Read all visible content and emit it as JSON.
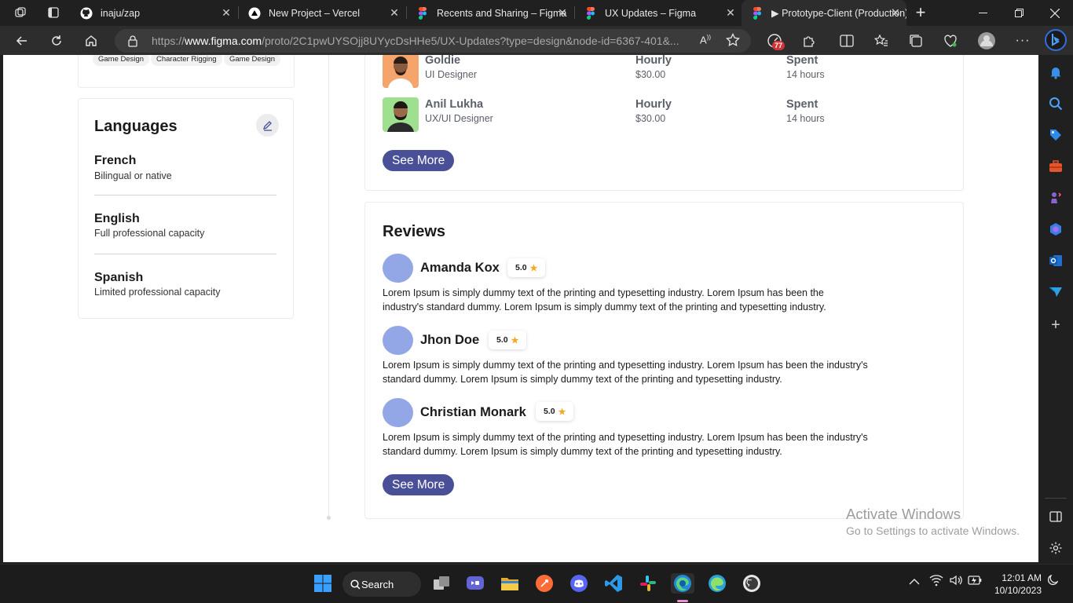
{
  "browser": {
    "tabs": [
      {
        "title": "inaju/zap",
        "active": false
      },
      {
        "title": "New Project – Vercel",
        "active": false
      },
      {
        "title": "Recents and Sharing – Figma",
        "active": false
      },
      {
        "title": "UX Updates – Figma",
        "active": false
      },
      {
        "title": "▶ Prototype-Client (Production)",
        "active": true
      }
    ],
    "url_prefix": "https://",
    "url_host": "www.figma.com",
    "url_path": "/proto/2C1pwUYSOjj8UYycDsHHe5/UX-Updates?type=design&node-id=6367-401&...",
    "extension_badge": "77",
    "accent": "#1a73e8"
  },
  "skills": {
    "chips": [
      "Game Design",
      "Character Rigging",
      "Game Design"
    ]
  },
  "languages": {
    "title": "Languages",
    "items": [
      {
        "name": "French",
        "level": "Bilingual or native"
      },
      {
        "name": "English",
        "level": "Full professional capacity"
      },
      {
        "name": "Spanish",
        "level": "Limited professional  capacity"
      }
    ]
  },
  "hires": {
    "rows": [
      {
        "name": "Goldie",
        "role": "UI Designer",
        "rate_label": "Hourly",
        "rate": "$30.00",
        "spent_label": "Spent",
        "spent": "14 hours"
      },
      {
        "name": "Anil Lukha",
        "role": "UX/UI Designer",
        "rate_label": "Hourly",
        "rate": "$30.00",
        "spent_label": "Spent",
        "spent": "14 hours"
      }
    ],
    "see_more": "See More"
  },
  "reviews": {
    "title": "Reviews",
    "items": [
      {
        "name": "Amanda Kox",
        "rating": "5.0",
        "text": "Lorem Ipsum is simply dummy text of the printing and typesetting industry. Lorem Ipsum has been the industry's standard dummy. Lorem Ipsum is simply dummy text of the printing and typesetting industry."
      },
      {
        "name": "Jhon Doe",
        "rating": "5.0",
        "text": "Lorem Ipsum is simply dummy text of the printing and typesetting industry. Lorem Ipsum has been the industry's standard dummy. Lorem Ipsum is simply dummy text of the printing and typesetting industry."
      },
      {
        "name": "Christian Monark",
        "rating": "5.0",
        "text": "Lorem Ipsum is simply dummy text of the printing and typesetting industry. Lorem Ipsum has been the industry's standard dummy. Lorem Ipsum is simply dummy text of the printing and typesetting industry."
      }
    ],
    "see_more": "See More"
  },
  "watermark": {
    "title": "Activate Windows",
    "subtitle": "Go to Settings to activate Windows."
  },
  "taskbar": {
    "search_label": "Search",
    "time": "12:01 AM",
    "date": "10/10/2023"
  },
  "colors": {
    "primary_button": "#4a5097",
    "avatar_placeholder": "#93a6e6",
    "star": "#f2a921"
  }
}
